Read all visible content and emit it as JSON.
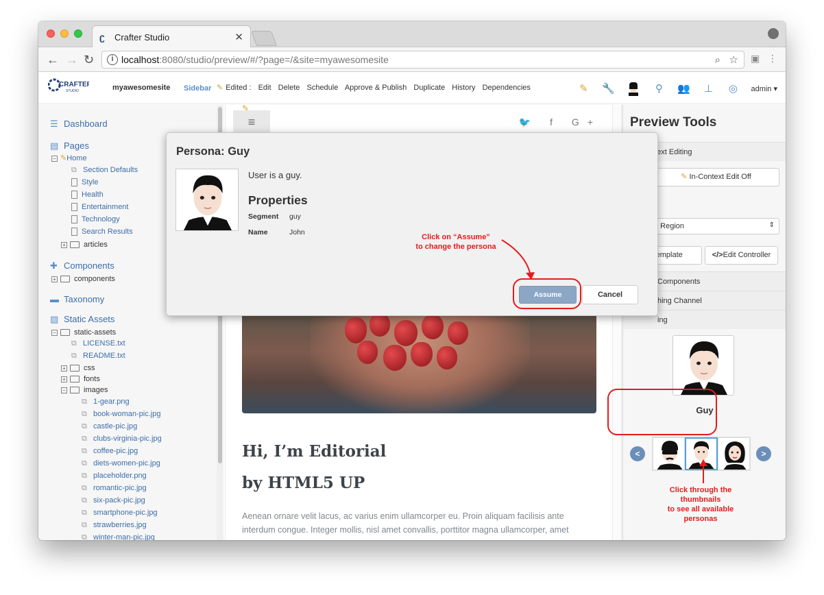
{
  "browser": {
    "tab_title": "Crafter Studio",
    "tab_close": "✕",
    "url_host": "localhost",
    "url_rest": ":8080/studio/preview/#/?page=/&site=myawesomesite",
    "info_glyph": "i",
    "icons": [
      "back-icon",
      "forward-icon",
      "reload-icon",
      "zoom-icon",
      "star-icon",
      "profile-icon",
      "menu-icon"
    ]
  },
  "studio": {
    "logo_text": "CRAFTER",
    "logo_sub": "STUDIO",
    "site_name": "myawesomesite",
    "sidebar_label": "Sidebar",
    "edited_label": "Edited :",
    "actions": [
      "Edit",
      "Delete",
      "Schedule",
      "Approve & Publish",
      "Duplicate",
      "History",
      "Dependencies"
    ],
    "user": "admin"
  },
  "sidebar": {
    "dashboard": "Dashboard",
    "pages": "Pages",
    "home": "Home",
    "home_children": [
      "Section Defaults",
      "Style",
      "Health",
      "Entertainment",
      "Technology",
      "Search Results"
    ],
    "articles": "articles",
    "components_title": "Components",
    "components_folder": "components",
    "taxonomy": "Taxonomy",
    "static_assets": "Static Assets",
    "static_assets_folder": "static-assets",
    "static_files": [
      "LICENSE.txt",
      "README.txt"
    ],
    "static_folders": [
      "css",
      "fonts"
    ],
    "images_folder": "images",
    "images": [
      "1-gear.png",
      "book-woman-pic.jpg",
      "castle-pic.jpg",
      "clubs-virginia-pic.jpg",
      "coffee-pic.jpg",
      "diets-women-pic.jpg",
      "placeholder.png",
      "romantic-pic.jpg",
      "six-pack-pic.jpg",
      "smartphone-pic.jpg",
      "strawberries.jpg",
      "winter-man-pic.jpg"
    ]
  },
  "preview": {
    "menu_glyph": "≡",
    "social": "  f  G+",
    "heading1": "Hi, I’m Editorial",
    "heading2": "by HTML5 UP",
    "paragraph": "Aenean ornare velit lacus, ac varius enim ullamcorper eu. Proin aliquam facilisis ante interdum congue. Integer mollis, nisl amet convallis, porttitor magna ullamcorper, amet"
  },
  "preview_tools": {
    "title": "Preview Tools",
    "in_context_section": "ntext Editing",
    "in_context_button": "In-Context Edit Off",
    "region_select": "o Region",
    "template_button": "t Template",
    "controller_button": "Edit Controller",
    "controller_glyph": "</>",
    "components_row": "Components",
    "channel_row": "hing Channel",
    "targeting_row": "ing",
    "current_persona": "Guy",
    "prev": "<",
    "next": ">"
  },
  "modal": {
    "title": "Persona: Guy",
    "description": "User is a guy.",
    "properties_heading": "Properties",
    "properties": [
      {
        "label": "Segment",
        "value": "guy"
      },
      {
        "label": "Name",
        "value": "John"
      }
    ],
    "assume_label": "Assume",
    "cancel_label": "Cancel"
  },
  "annotations": {
    "assume_callout": [
      "Click on “Assume”",
      "to change the persona"
    ],
    "thumbs_callout": [
      "Click through the",
      "thumbnails",
      "to see all available",
      "personas"
    ],
    "color": "#e51b1b"
  }
}
